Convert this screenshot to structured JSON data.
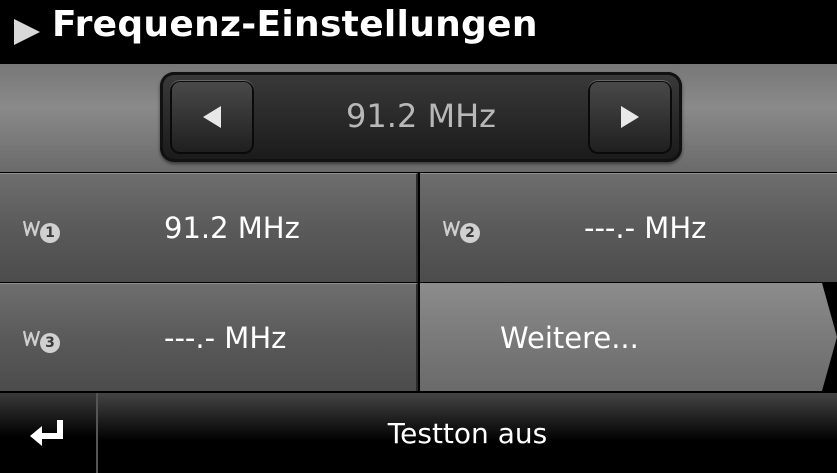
{
  "title": "Frequenz-Einstellungen",
  "frequency": {
    "current": "91.2 MHz"
  },
  "presets": [
    {
      "number": "1",
      "value": "91.2 MHz"
    },
    {
      "number": "2",
      "value": "---.- MHz"
    },
    {
      "number": "3",
      "value": "---.- MHz"
    }
  ],
  "more_label": "Weitere...",
  "bottom": {
    "testton_label": "Testton aus"
  },
  "icons": {
    "title": "play-arrow-icon",
    "prev": "left-arrow-icon",
    "next": "right-arrow-icon",
    "preset": "radio-wave-icon",
    "back": "return-icon"
  },
  "colors": {
    "background": "#000000",
    "panel": "#6a6a6a",
    "text": "#ffffff",
    "display_text": "#b8b8b8"
  }
}
